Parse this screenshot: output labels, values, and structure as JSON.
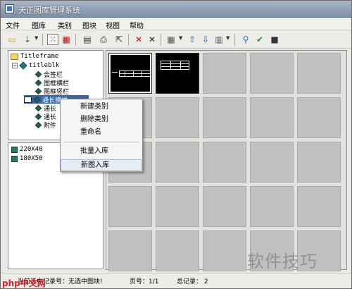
{
  "window": {
    "title": "天正图库管理系统"
  },
  "menu": [
    "文件",
    "图库",
    "类别",
    "图块",
    "视图",
    "帮助"
  ],
  "toolbar": {
    "buttons": [
      {
        "name": "open-folder-icon",
        "glyph": "▭"
      },
      {
        "name": "import-icon",
        "glyph": "⇣"
      },
      {
        "name": "grid-select-icon",
        "glyph": "⁙"
      },
      {
        "name": "pattern-icon",
        "glyph": "▦"
      },
      {
        "name": "card-icon",
        "glyph": "▤"
      },
      {
        "name": "print-icon",
        "glyph": "⎙"
      },
      {
        "name": "export-icon",
        "glyph": "⇱"
      },
      {
        "name": "delete-icon",
        "glyph": "✕"
      },
      {
        "name": "cut-icon",
        "glyph": "✕"
      },
      {
        "name": "view-layout-icon",
        "glyph": "▦"
      },
      {
        "name": "move-up-icon",
        "glyph": "⇧"
      },
      {
        "name": "move-down-icon",
        "glyph": "⇩"
      },
      {
        "name": "list-view-icon",
        "glyph": "▥"
      },
      {
        "name": "pin-icon",
        "glyph": "⚲"
      },
      {
        "name": "check-icon",
        "glyph": "✔"
      },
      {
        "name": "stop-icon",
        "glyph": "■"
      }
    ]
  },
  "tree": {
    "root": "Titleframe",
    "group": "titleblk",
    "items": [
      "会签栏",
      "图框横栏",
      "图框竖栏",
      "通长横栏",
      "通长",
      "通长",
      "附件"
    ]
  },
  "list": [
    "220X40",
    "180X50"
  ],
  "context_menu": {
    "items": [
      "新建类别",
      "删除类别",
      "重命名",
      "批量入库",
      "新图入库"
    ],
    "hover_index": 4
  },
  "status": {
    "current": "当前选中记录号：无选中图块!",
    "page": "页号：1/1",
    "total": "总记录： 2"
  },
  "watermark": {
    "text": "软件技巧",
    "logo": "php中文网"
  },
  "colors": {
    "titlebar": "#8a9ab0",
    "cell": "#c0c0c0",
    "thumb_bg": "#000000",
    "selection": "#3465a4"
  }
}
